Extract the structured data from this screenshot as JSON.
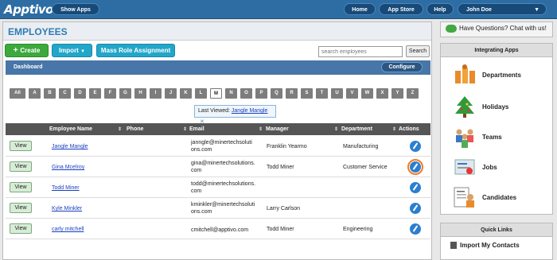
{
  "header": {
    "logo": "Apptivo",
    "show_apps": "Show Apps",
    "nav": [
      "Home",
      "App Store",
      "Help"
    ],
    "user": "John Doe",
    "chevron": "▼"
  },
  "page": {
    "title": "EMPLOYEES",
    "create": "Create",
    "import": "Import",
    "mass_role": "Mass Role Assignment",
    "search_placeholder": "search employees",
    "search_button": "Search",
    "dashboard": "Dashboard",
    "configure": "Configure"
  },
  "alphabet": [
    "All",
    "A",
    "B",
    "C",
    "D",
    "E",
    "F",
    "G",
    "H",
    "I",
    "J",
    "K",
    "L",
    "M",
    "N",
    "O",
    "P",
    "Q",
    "R",
    "S",
    "T",
    "U",
    "V",
    "W",
    "X",
    "Y",
    "Z"
  ],
  "selected_letter": "M",
  "last_viewed": {
    "label": "Last Viewed:",
    "name": "Jangle Mangle",
    "close": "✕"
  },
  "table": {
    "columns": [
      "Employee Name",
      "Phone",
      "Email",
      "Manager",
      "Department",
      "Actions"
    ],
    "view_label": "View",
    "rows": [
      {
        "name": "Jangle Mangle",
        "phone": "",
        "email1": "janngle@minertechsoluti",
        "email2": "ons.com",
        "manager": "Franklin Yearmo",
        "department": "Manufacturing"
      },
      {
        "name": "Gina Mcelroy",
        "phone": "",
        "email1": "gina@minertechsolutions.",
        "email2": "com",
        "manager": "Todd Miner",
        "department": "Customer Service"
      },
      {
        "name": "Todd Miner",
        "phone": "",
        "email1": "todd@minertechsolutions.",
        "email2": "com",
        "manager": "",
        "department": ""
      },
      {
        "name": "Kyle Minkler",
        "phone": "",
        "email1": "kminkler@minertechsoluti",
        "email2": "ons.com",
        "manager": "Larry Carlson",
        "department": ""
      },
      {
        "name": "carly mitchell",
        "phone": "",
        "email1": "cmitchell@apptivo.com",
        "email2": "",
        "manager": "Todd Miner",
        "department": "Engineering"
      }
    ]
  },
  "sidebar": {
    "chat": "Have Questions? Chat with us!",
    "integrating_title": "Integrating Apps",
    "apps": [
      "Departments",
      "Holidays",
      "Teams",
      "Jobs",
      "Candidates"
    ],
    "quick_links_title": "Quick Links",
    "quick_links": [
      "Import My Contacts"
    ]
  }
}
